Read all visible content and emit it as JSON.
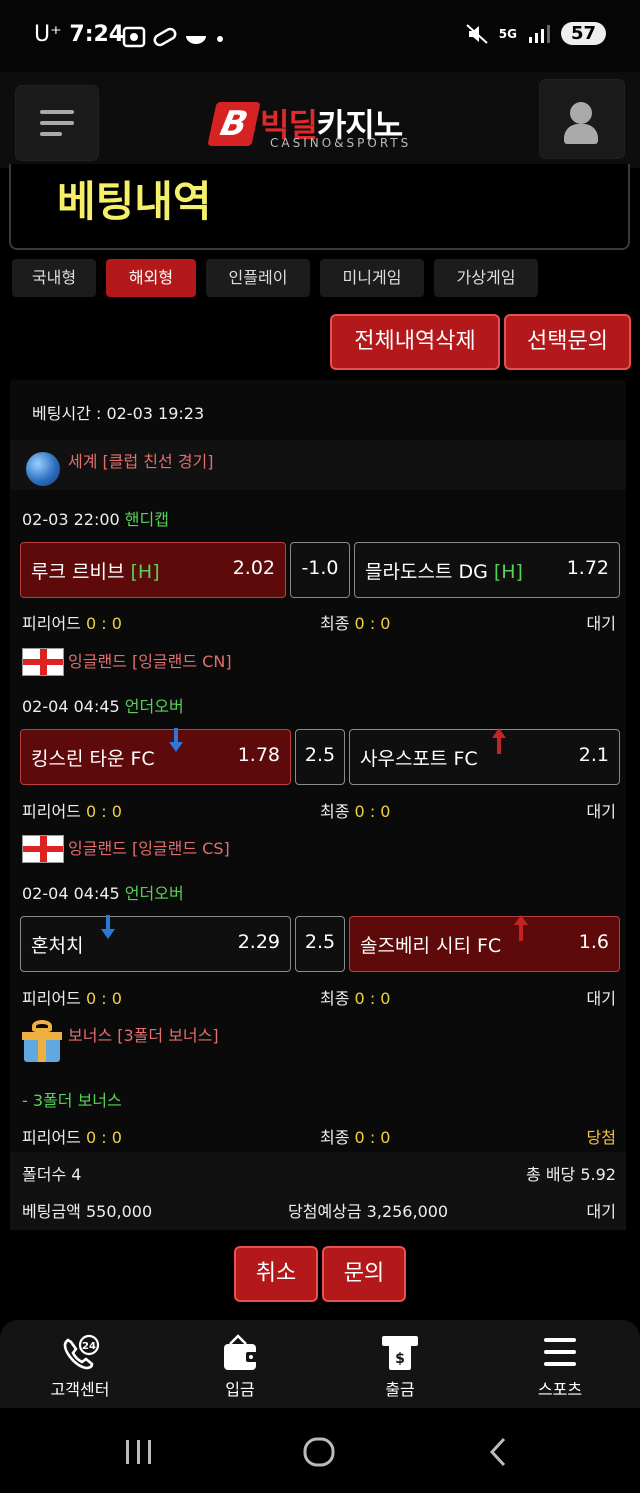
{
  "status_bar": {
    "carrier": "U⁺",
    "time": "7:24",
    "network": "5G",
    "battery": "57"
  },
  "header": {
    "logo_letter": "B",
    "logo_text_red": "빅딜",
    "logo_text_white": "카지노",
    "logo_sub": "CASINO&SPORTS"
  },
  "page_title": "베팅내역",
  "tabs": [
    {
      "label": "국내형",
      "active": false
    },
    {
      "label": "해외형",
      "active": true
    },
    {
      "label": "인플레이",
      "active": false
    },
    {
      "label": "미니게임",
      "active": false
    },
    {
      "label": "가상게임",
      "active": false
    }
  ],
  "actions": {
    "delete_all": "전체내역삭제",
    "inquire_selected": "선택문의"
  },
  "bet": {
    "bet_time": "베팅시간 : 02-03 19:23",
    "games": [
      {
        "league": "세계 [클럽 친선 경기]",
        "datetime": "02-03 22:00",
        "market": "핸디캡",
        "home": {
          "name": "루크 르비브",
          "tag": "[H]",
          "odds": "2.02"
        },
        "line": "-1.0",
        "away": {
          "name": "믈라도스트 DG",
          "tag": "[H]",
          "odds": "1.72"
        },
        "period_label": "피리어드",
        "period_score": "0 : 0",
        "final_label": "최종",
        "final_score": "0 : 0",
        "status": "대기"
      },
      {
        "league": "잉글랜드 [잉글랜드 CN]",
        "datetime": "02-04 04:45",
        "market": "언더오버",
        "home": {
          "name": "킹스린 타운 FC",
          "odds": "1.78"
        },
        "line": "2.5",
        "away": {
          "name": "사우스포트 FC",
          "odds": "2.1"
        },
        "period_label": "피리어드",
        "period_score": "0 : 0",
        "final_label": "최종",
        "final_score": "0 : 0",
        "status": "대기"
      },
      {
        "league": "잉글랜드 [잉글랜드 CS]",
        "datetime": "02-04 04:45",
        "market": "언더오버",
        "home": {
          "name": "혼처치",
          "odds": "2.29"
        },
        "line": "2.5",
        "away": {
          "name": "솔즈베리 시티 FC",
          "odds": "1.6"
        },
        "period_label": "피리어드",
        "period_score": "0 : 0",
        "final_label": "최종",
        "final_score": "0 : 0",
        "status": "대기"
      }
    ],
    "bonus": {
      "league": "보너스 [3폴더 보너스]",
      "name": "- 3폴더 보너스",
      "period_label": "피리어드",
      "period_score": "0 : 0",
      "final_label": "최종",
      "final_score": "0 : 0",
      "status": "당첨"
    },
    "folder_count": "폴더수 4",
    "total_odds": "총 배당 5.92",
    "bet_amount": "베팅금액 550,000",
    "expected_win": "당첨예상금 3,256,000",
    "status": "대기"
  },
  "bottom_buttons": {
    "cancel": "취소",
    "inquire": "문의"
  },
  "bottom_nav": [
    {
      "label": "고객센터",
      "icon": "support-24-icon"
    },
    {
      "label": "입금",
      "icon": "wallet-icon"
    },
    {
      "label": "출금",
      "icon": "atm-withdraw-icon"
    },
    {
      "label": "스포츠",
      "icon": "menu-lines-icon"
    }
  ],
  "colors": {
    "accent_red": "#b3181b",
    "title_yellow": "#f5f06a",
    "league_red": "#e46d6d",
    "green": "#58d158",
    "win_gold": "#f0c040"
  }
}
